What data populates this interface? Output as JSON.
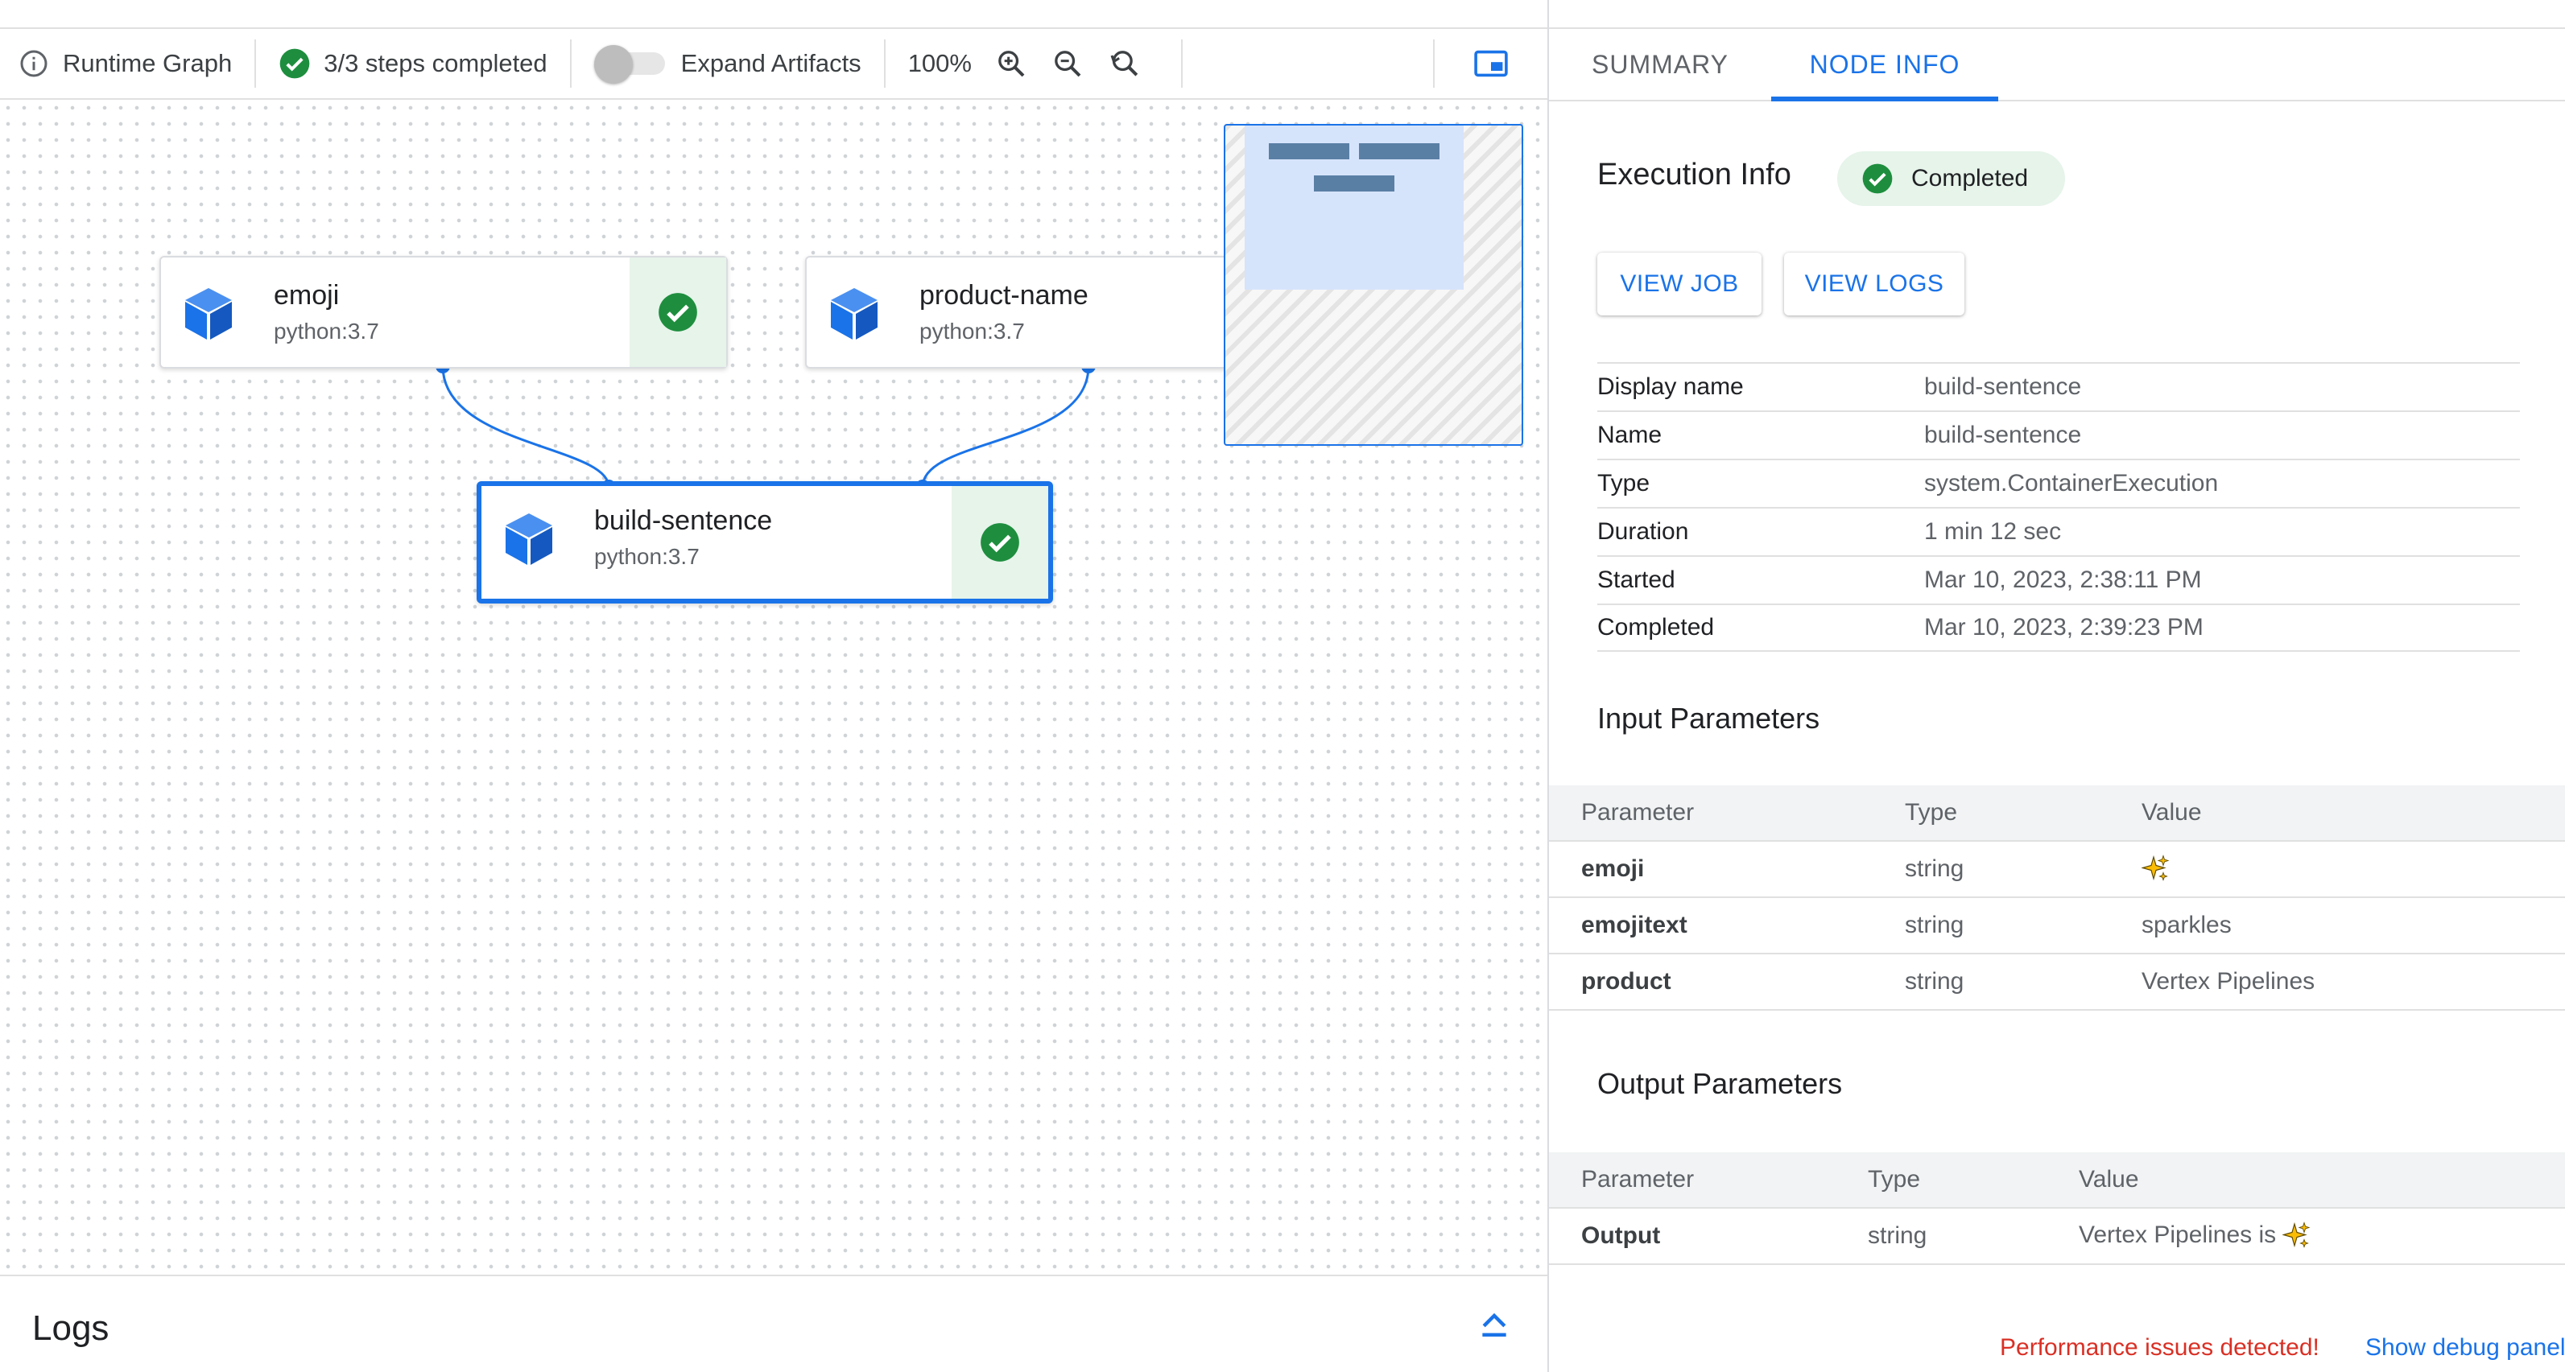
{
  "toolbar": {
    "runtime_graph_label": "Runtime Graph",
    "steps_completed_label": "3/3 steps completed",
    "expand_artifacts_label": "Expand Artifacts",
    "zoom_level": "100%",
    "icons": [
      "info-icon",
      "check-circle-icon",
      "zoom-in-icon",
      "zoom-out-icon",
      "zoom-reset-icon",
      "picture-in-picture-icon"
    ]
  },
  "graph": {
    "nodes": [
      {
        "title": "emoji",
        "subtitle": "python:3.7",
        "status": "succeeded"
      },
      {
        "title": "product-name",
        "subtitle": "python:3.7",
        "status": "succeeded"
      },
      {
        "title": "build-sentence",
        "subtitle": "python:3.7",
        "status": "succeeded",
        "selected": true
      }
    ],
    "edges": [
      {
        "from": "emoji",
        "to": "build-sentence"
      },
      {
        "from": "product-name",
        "to": "build-sentence"
      }
    ]
  },
  "logs": {
    "title": "Logs"
  },
  "tabs": [
    {
      "label": "SUMMARY",
      "active": false
    },
    {
      "label": "NODE INFO",
      "active": true
    }
  ],
  "execution_info": {
    "title": "Execution Info",
    "status": "Completed",
    "view_job_label": "VIEW JOB",
    "view_logs_label": "VIEW LOGS",
    "rows": [
      {
        "key": "Display name",
        "value": "build-sentence"
      },
      {
        "key": "Name",
        "value": "build-sentence"
      },
      {
        "key": "Type",
        "value": "system.ContainerExecution"
      },
      {
        "key": "Duration",
        "value": "1 min 12 sec"
      },
      {
        "key": "Started",
        "value": "Mar 10, 2023, 2:38:11 PM"
      },
      {
        "key": "Completed",
        "value": "Mar 10, 2023, 2:39:23 PM"
      }
    ]
  },
  "input_parameters": {
    "title": "Input Parameters",
    "headers": [
      "Parameter",
      "Type",
      "Value"
    ],
    "rows": [
      {
        "parameter": "emoji",
        "type": "string",
        "value": "",
        "value_icon": "sparkles-emoji"
      },
      {
        "parameter": "emojitext",
        "type": "string",
        "value": "sparkles"
      },
      {
        "parameter": "product",
        "type": "string",
        "value": "Vertex Pipelines"
      }
    ]
  },
  "output_parameters": {
    "title": "Output Parameters",
    "headers": [
      "Parameter",
      "Type",
      "Value"
    ],
    "rows": [
      {
        "parameter": "Output",
        "type": "string",
        "value": "Vertex Pipelines is",
        "value_icon": "sparkles-emoji"
      }
    ]
  },
  "footer": {
    "performance_warning": "Performance issues detected!",
    "debug_panel_link": "Show debug panel"
  },
  "colors": {
    "accent": "#1a73e8",
    "success": "#1e8e3e",
    "success_bg": "#e6f4ea",
    "warning_text": "#d93025"
  }
}
